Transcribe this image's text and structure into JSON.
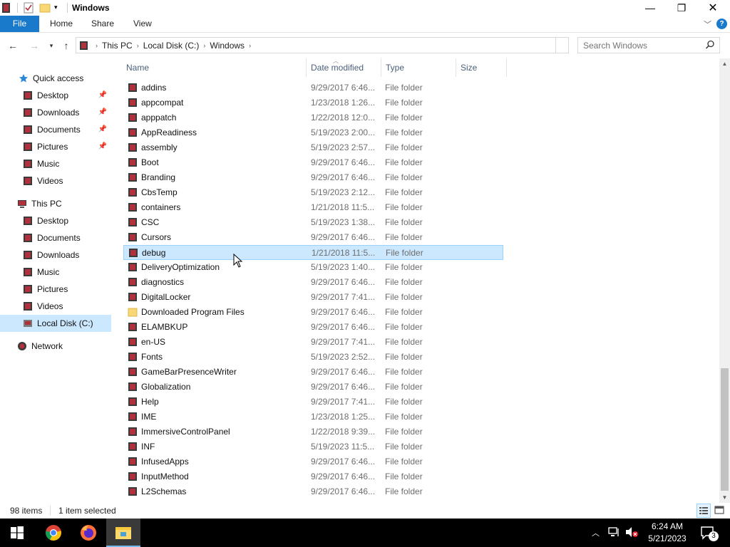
{
  "window": {
    "title": "Windows",
    "controls": {
      "minimize": "—",
      "restore": "❐",
      "close": "✕"
    }
  },
  "ribbon": {
    "tabs": [
      "File",
      "Home",
      "Share",
      "View"
    ],
    "help": "?"
  },
  "address": {
    "crumbs": [
      "This PC",
      "Local Disk (C:)",
      "Windows"
    ],
    "search_placeholder": "Search Windows"
  },
  "nav": {
    "quick_access": {
      "label": "Quick access",
      "items": [
        {
          "label": "Desktop",
          "pinned": true
        },
        {
          "label": "Downloads",
          "pinned": true
        },
        {
          "label": "Documents",
          "pinned": true
        },
        {
          "label": "Pictures",
          "pinned": true
        },
        {
          "label": "Music",
          "pinned": false
        },
        {
          "label": "Videos",
          "pinned": false
        }
      ]
    },
    "this_pc": {
      "label": "This PC",
      "items": [
        {
          "label": "Desktop"
        },
        {
          "label": "Documents"
        },
        {
          "label": "Downloads"
        },
        {
          "label": "Music"
        },
        {
          "label": "Pictures"
        },
        {
          "label": "Videos"
        },
        {
          "label": "Local Disk (C:)",
          "selected": true
        }
      ]
    },
    "network": {
      "label": "Network"
    }
  },
  "columns": {
    "name": "Name",
    "date": "Date modified",
    "type": "Type",
    "size": "Size"
  },
  "files": [
    {
      "name": "addins",
      "date": "9/29/2017 6:46...",
      "type": "File folder"
    },
    {
      "name": "appcompat",
      "date": "1/23/2018 1:26...",
      "type": "File folder"
    },
    {
      "name": "apppatch",
      "date": "1/22/2018 12:0...",
      "type": "File folder"
    },
    {
      "name": "AppReadiness",
      "date": "5/19/2023 2:00...",
      "type": "File folder"
    },
    {
      "name": "assembly",
      "date": "5/19/2023 2:57...",
      "type": "File folder"
    },
    {
      "name": "Boot",
      "date": "9/29/2017 6:46...",
      "type": "File folder"
    },
    {
      "name": "Branding",
      "date": "9/29/2017 6:46...",
      "type": "File folder"
    },
    {
      "name": "CbsTemp",
      "date": "5/19/2023 2:12...",
      "type": "File folder"
    },
    {
      "name": "containers",
      "date": "1/21/2018 11:5...",
      "type": "File folder"
    },
    {
      "name": "CSC",
      "date": "5/19/2023 1:38...",
      "type": "File folder"
    },
    {
      "name": "Cursors",
      "date": "9/29/2017 6:46...",
      "type": "File folder"
    },
    {
      "name": "debug",
      "date": "1/21/2018 11:5...",
      "type": "File folder",
      "selected": true
    },
    {
      "name": "DeliveryOptimization",
      "date": "5/19/2023 1:40...",
      "type": "File folder"
    },
    {
      "name": "diagnostics",
      "date": "9/29/2017 6:46...",
      "type": "File folder"
    },
    {
      "name": "DigitalLocker",
      "date": "9/29/2017 7:41...",
      "type": "File folder"
    },
    {
      "name": "Downloaded Program Files",
      "date": "9/29/2017 6:46...",
      "type": "File folder",
      "plain": true
    },
    {
      "name": "ELAMBKUP",
      "date": "9/29/2017 6:46...",
      "type": "File folder"
    },
    {
      "name": "en-US",
      "date": "9/29/2017 7:41...",
      "type": "File folder"
    },
    {
      "name": "Fonts",
      "date": "5/19/2023 2:52...",
      "type": "File folder"
    },
    {
      "name": "GameBarPresenceWriter",
      "date": "9/29/2017 6:46...",
      "type": "File folder"
    },
    {
      "name": "Globalization",
      "date": "9/29/2017 6:46...",
      "type": "File folder"
    },
    {
      "name": "Help",
      "date": "9/29/2017 7:41...",
      "type": "File folder"
    },
    {
      "name": "IME",
      "date": "1/23/2018 1:25...",
      "type": "File folder"
    },
    {
      "name": "ImmersiveControlPanel",
      "date": "1/22/2018 9:39...",
      "type": "File folder"
    },
    {
      "name": "INF",
      "date": "5/19/2023 11:5...",
      "type": "File folder"
    },
    {
      "name": "InfusedApps",
      "date": "9/29/2017 6:46...",
      "type": "File folder"
    },
    {
      "name": "InputMethod",
      "date": "9/29/2017 6:46...",
      "type": "File folder"
    },
    {
      "name": "L2Schemas",
      "date": "9/29/2017 6:46...",
      "type": "File folder"
    }
  ],
  "status": {
    "item_count": "98 items",
    "selection": "1 item selected"
  },
  "taskbar": {
    "clock_time": "6:24 AM",
    "clock_date": "5/21/2023",
    "notification_count": "3"
  },
  "colors": {
    "accent": "#1979ca",
    "selection": "#cce8ff",
    "selection_border": "#99d1ff"
  }
}
